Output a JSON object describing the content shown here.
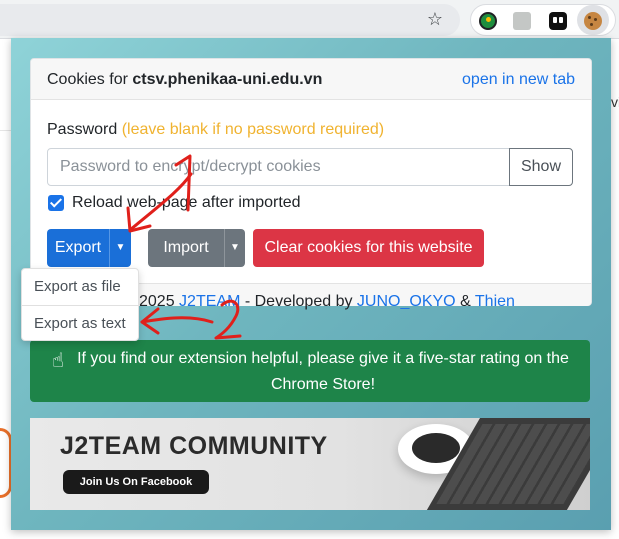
{
  "popup": {
    "header": {
      "prefix": "Cookies for",
      "domain": "ctsv.phenikaa-uni.edu.vn",
      "open_tab": "open in new tab"
    },
    "password": {
      "label": "Password",
      "hint": "(leave blank if no password required)",
      "placeholder": "Password to encrypt/decrypt cookies",
      "show_label": "Show"
    },
    "reload_checkbox": {
      "label": "Reload web-page after imported",
      "checked": true
    },
    "buttons": {
      "export": "Export",
      "import": "Import",
      "clear": "Clear cookies for this website"
    },
    "export_menu": [
      "Export as file",
      "Export as text"
    ],
    "credits": {
      "year": "2025",
      "team": "J2TEAM",
      "developed_by": "- Developed by",
      "dev1": "JUNO_OKYO",
      "amp": "&",
      "dev2": "Thien"
    },
    "rating_text": "If you find our extension helpful, please give it a five-star rating on the Chrome Store!",
    "banner": {
      "title": "J2TEAM COMMUNITY",
      "button": "Join Us On Facebook"
    }
  },
  "browser": {
    "bookmark_icon": "star-icon",
    "page_fragment": "vi"
  },
  "annotations": {
    "step1": "1",
    "step2": "2",
    "color": "#e0201b"
  },
  "colors": {
    "primary": "#1a6fd8",
    "secondary": "#6c757d",
    "danger": "#dc3545",
    "success": "#1e8449",
    "link": "#1a73e8",
    "hint": "#f0b330"
  }
}
